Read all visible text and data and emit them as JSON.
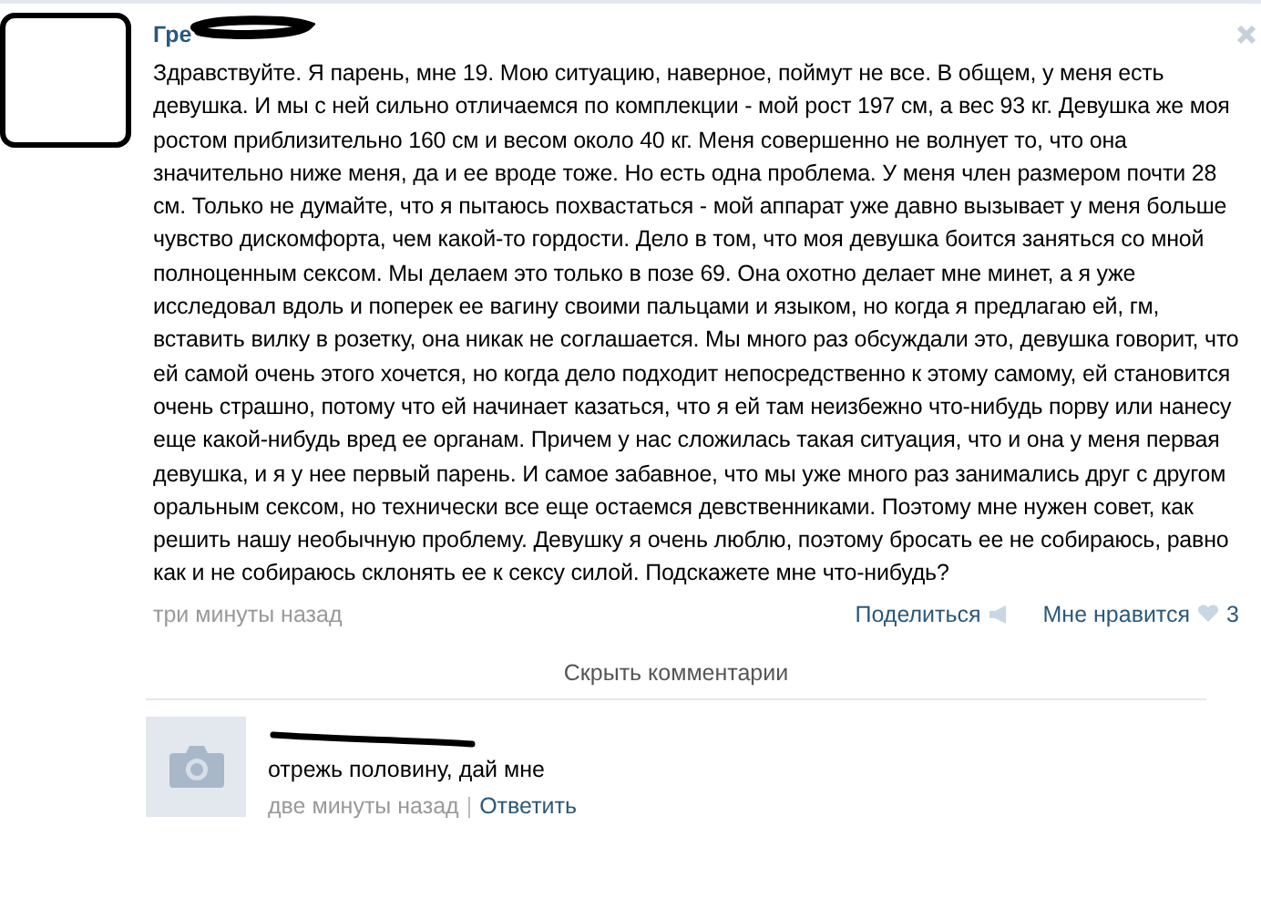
{
  "post": {
    "author": "Гре",
    "text": "Здравствуйте. Я парень, мне 19. Мою ситуацию, наверное, поймут не все. В общем, у меня есть девушка. И мы с ней сильно отличаемся по комплекции - мой рост 197 см, а вес 93 кг. Девушка же моя ростом приблизительно 160 см и весом около 40 кг. Меня совершенно не волнует то, что она значительно ниже меня, да и ее вроде тоже. Но есть одна проблема. У меня член размером почти 28 см. Только не думайте, что я пытаюсь похвастаться - мой аппарат уже давно вызывает у меня больше чувство дискомфорта, чем какой-то гордости. Дело в том, что моя девушка боится заняться со мной полноценным сексом. Мы делаем это только в позе 69. Она охотно делает мне минет, а я уже исследовал вдоль и поперек ее вагину своими пальцами и языком, но когда я предлагаю ей, гм, вставить вилку в розетку, она никак не соглашается. Мы много раз обсуждали это, девушка говорит, что ей самой очень этого хочется, но когда дело подходит непосредственно к этому самому, ей становится очень страшно, потому что ей начинает казаться, что я ей там неизбежно что-нибудь порву или нанесу еще какой-нибудь вред ее органам. Причем у нас сложилась такая ситуация, что и она у меня первая девушка, и я у нее первый парень. И самое забавное, что мы уже много раз занимались друг с другом оральным сексом, но технически все еще остаемся девственниками. Поэтому мне нужен совет, как решить нашу необычную проблему. Девушку я очень люблю, поэтому бросать ее не собираюсь, равно как и не собираюсь склонять ее к сексу силой. Подскажете мне что-нибудь?",
    "time": "три минуты назад",
    "share": "Поделиться",
    "like": "Мне нравится",
    "like_count": "3"
  },
  "hide_comments": "Скрыть комментарии",
  "comments": [
    {
      "text": "отрежь половину, дай мне",
      "time": "две минуты назад",
      "separator": "|",
      "reply": "Ответить"
    }
  ]
}
